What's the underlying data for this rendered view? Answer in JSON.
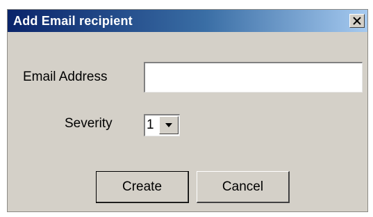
{
  "dialog": {
    "title": "Add Email recipient",
    "close_icon": "close-x-icon"
  },
  "form": {
    "email_label": "Email Address",
    "email_value": "",
    "severity_label": "Severity",
    "severity_value": "1",
    "dropdown_icon": "chevron-down-icon"
  },
  "buttons": {
    "create_label": "Create",
    "cancel_label": "Cancel"
  },
  "colors": {
    "titlebar_start": "#0a246a",
    "titlebar_end": "#a6caf0",
    "dialog_background": "#d4d0c8"
  }
}
